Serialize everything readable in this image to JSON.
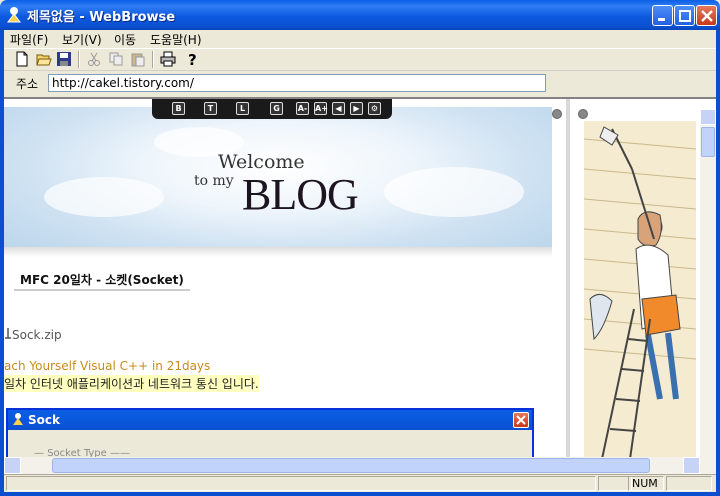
{
  "window": {
    "title": "제목없음 - WebBrowse"
  },
  "menu": {
    "items": [
      "파일(F)",
      "보기(V)",
      "이동",
      "도움말(H)"
    ]
  },
  "toolbar": {
    "icons": [
      "new-file-icon",
      "open-folder-icon",
      "save-icon",
      "cut-icon",
      "copy-icon",
      "paste-icon",
      "print-icon",
      "help-icon"
    ]
  },
  "address": {
    "label": "주소",
    "value": "http://cakel.tistory.com/"
  },
  "blog": {
    "toolbar_buttons": [
      "B",
      "T",
      "L",
      "G",
      "A-",
      "A+",
      "◀",
      "▶",
      "⚙"
    ],
    "welcome": "Welcome",
    "to_my": "to my",
    "blog_word": "BLOG",
    "post_title": "MFC 20일차 - 소켓(Socket)",
    "attachment": "Sock.zip",
    "book_title": "ach Yourself Visual C++ in 21days",
    "description": "일차 인터넷 애플리케이션과 네트워크 통신 입니다."
  },
  "dialog": {
    "title": "Sock",
    "group_label": "Socket Type"
  },
  "status": {
    "num": "NUM"
  },
  "colors": {
    "titlebar": "#0b4fd0",
    "chrome": "#ece9d8",
    "book_title": "#c98a1c",
    "highlight": "#ffffc0"
  }
}
